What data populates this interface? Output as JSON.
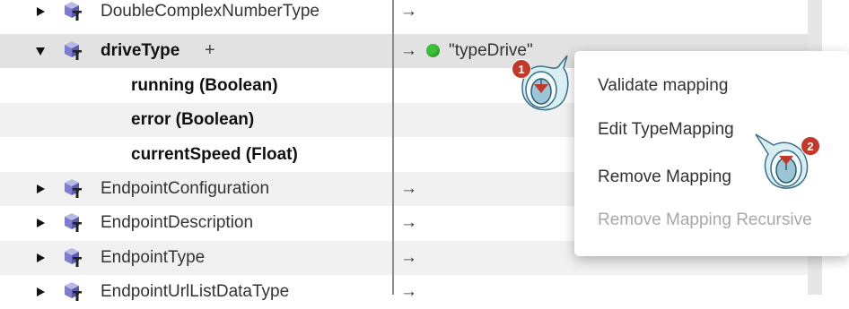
{
  "tree": {
    "rows": [
      {
        "label": "DoubleComplexNumberType",
        "arrow": "→"
      },
      {
        "label": "driveType",
        "plus": "+",
        "arrow": "→",
        "mapping": "\"typeDrive\"",
        "mapping_status_color": "#3cc13c"
      },
      {
        "label": "running (Boolean)"
      },
      {
        "label": "error (Boolean)"
      },
      {
        "label": "currentSpeed (Float)"
      },
      {
        "label": "EndpointConfiguration",
        "arrow": "→"
      },
      {
        "label": "EndpointDescription",
        "arrow": "→"
      },
      {
        "label": "EndpointType",
        "arrow": "→"
      },
      {
        "label": "EndpointUrlListDataType",
        "arrow": "→"
      }
    ],
    "icons": {
      "expander_collapsed": "triangle-right-icon",
      "expander_expanded": "triangle-down-icon",
      "type": "data-type-cube-icon"
    }
  },
  "context_menu": {
    "items": [
      {
        "label": "Validate mapping",
        "enabled": true
      },
      {
        "label": "Edit TypeMapping",
        "enabled": true
      },
      {
        "label": "Remove Mapping",
        "enabled": true
      },
      {
        "label": "Remove Mapping Recursive",
        "enabled": false
      }
    ]
  },
  "callouts": [
    {
      "number": "1",
      "icon": "mouse-click-icon"
    },
    {
      "number": "2",
      "icon": "mouse-click-icon"
    }
  ],
  "colors": {
    "badge": "#c0392b",
    "selected_row": "#e2e2e2",
    "alt_row": "#f1f1f1",
    "status_ok": "#3cc13c"
  }
}
